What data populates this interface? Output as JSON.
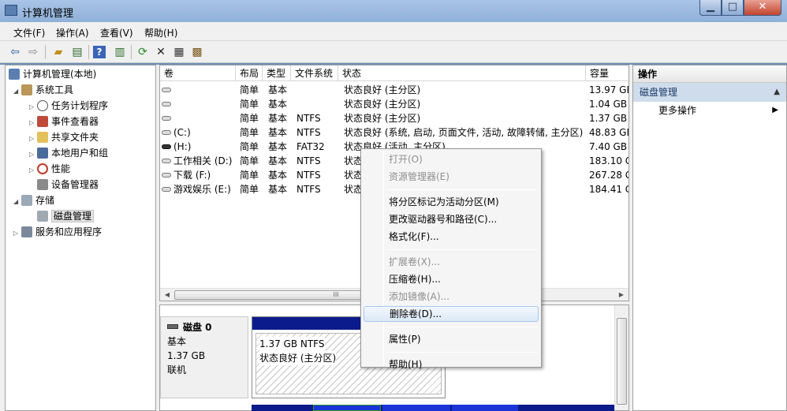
{
  "window": {
    "title": "计算机管理"
  },
  "menu": [
    "文件(F)",
    "操作(A)",
    "查看(V)",
    "帮助(H)"
  ],
  "toolbar": {
    "icons": [
      "back-icon",
      "forward-icon",
      "up-folder-icon",
      "show-hide-tree-icon",
      "help-icon",
      "show-hide-action-icon",
      "refresh-icon",
      "delete-icon",
      "properties-icon",
      "help-topic-icon"
    ]
  },
  "tree": [
    {
      "label": "计算机管理(本地)",
      "icon": "computer-icon",
      "level": 0,
      "expander": ""
    },
    {
      "label": "系统工具",
      "icon": "tools-icon",
      "level": 1,
      "expander": "◢"
    },
    {
      "label": "任务计划程序",
      "icon": "clock-icon",
      "level": 2,
      "expander": "▷"
    },
    {
      "label": "事件查看器",
      "icon": "event-viewer-icon",
      "level": 2,
      "expander": "▷"
    },
    {
      "label": "共享文件夹",
      "icon": "shared-folder-icon",
      "level": 2,
      "expander": "▷"
    },
    {
      "label": "本地用户和组",
      "icon": "users-icon",
      "level": 2,
      "expander": "▷"
    },
    {
      "label": "性能",
      "icon": "performance-icon",
      "level": 2,
      "expander": "▷"
    },
    {
      "label": "设备管理器",
      "icon": "device-manager-icon",
      "level": 2,
      "expander": ""
    },
    {
      "label": "存储",
      "icon": "storage-icon",
      "level": 1,
      "expander": "◢"
    },
    {
      "label": "磁盘管理",
      "icon": "disk-management-icon",
      "level": 2,
      "expander": ""
    },
    {
      "label": "服务和应用程序",
      "icon": "services-icon",
      "level": 1,
      "expander": "▷"
    }
  ],
  "volumes": {
    "columns": [
      "卷",
      "布局",
      "类型",
      "文件系统",
      "状态",
      "容量"
    ],
    "rows": [
      {
        "name": "",
        "layout": "简单",
        "type": "基本",
        "fs": "",
        "status": "状态良好 (主分区)",
        "capacity": "13.97 GB",
        "usb": false
      },
      {
        "name": "",
        "layout": "简单",
        "type": "基本",
        "fs": "",
        "status": "状态良好 (主分区)",
        "capacity": "1.04 GB",
        "usb": false
      },
      {
        "name": "",
        "layout": "简单",
        "type": "基本",
        "fs": "NTFS",
        "status": "状态良好 (主分区)",
        "capacity": "1.37 GB",
        "usb": false
      },
      {
        "name": "(C:)",
        "layout": "简单",
        "type": "基本",
        "fs": "NTFS",
        "status": "状态良好 (系统, 启动, 页面文件, 活动, 故障转储, 主分区)",
        "capacity": "48.83 GB",
        "usb": false
      },
      {
        "name": "(H:)",
        "layout": "简单",
        "type": "基本",
        "fs": "FAT32",
        "status": "状态良好 (活动, 主分区)",
        "capacity": "7.40 GB",
        "usb": true
      },
      {
        "name": "工作相关 (D:)",
        "layout": "简单",
        "type": "基本",
        "fs": "NTFS",
        "status": "状态",
        "capacity": "183.10 G",
        "usb": false
      },
      {
        "name": "下载 (F:)",
        "layout": "简单",
        "type": "基本",
        "fs": "NTFS",
        "status": "状态",
        "capacity": "267.28 G",
        "usb": false
      },
      {
        "name": "游戏娱乐 (E:)",
        "layout": "简单",
        "type": "基本",
        "fs": "NTFS",
        "status": "状态",
        "capacity": "184.41 G",
        "usb": false
      }
    ],
    "scroll_grip": "III"
  },
  "disk": {
    "name": "磁盘 0",
    "type": "基本",
    "size": "1.37 GB",
    "state": "联机",
    "partition_size": "1.37 GB NTFS",
    "partition_status": "状态良好 (主分区)"
  },
  "actions": {
    "header": "操作",
    "group": "磁盘管理",
    "more": "更多操作"
  },
  "context_menu": [
    {
      "label": "打开(O)",
      "disabled": true
    },
    {
      "label": "资源管理器(E)",
      "disabled": true
    },
    {
      "sep": true
    },
    {
      "label": "将分区标记为活动分区(M)",
      "disabled": false
    },
    {
      "label": "更改驱动器号和路径(C)...",
      "disabled": false
    },
    {
      "label": "格式化(F)...",
      "disabled": false
    },
    {
      "sep": true
    },
    {
      "label": "扩展卷(X)...",
      "disabled": true
    },
    {
      "label": "压缩卷(H)...",
      "disabled": false
    },
    {
      "label": "添加镜像(A)...",
      "disabled": true
    },
    {
      "label": "删除卷(D)...",
      "disabled": false,
      "hover": true
    },
    {
      "sep": true
    },
    {
      "label": "属性(P)",
      "disabled": false
    },
    {
      "sep": true
    },
    {
      "label": "帮助(H)",
      "disabled": false
    }
  ],
  "colors": {
    "primary_partition": "#0c1b8c",
    "selection_border": "#a8c7ef",
    "actions_group_bg": "#cfdcec"
  }
}
